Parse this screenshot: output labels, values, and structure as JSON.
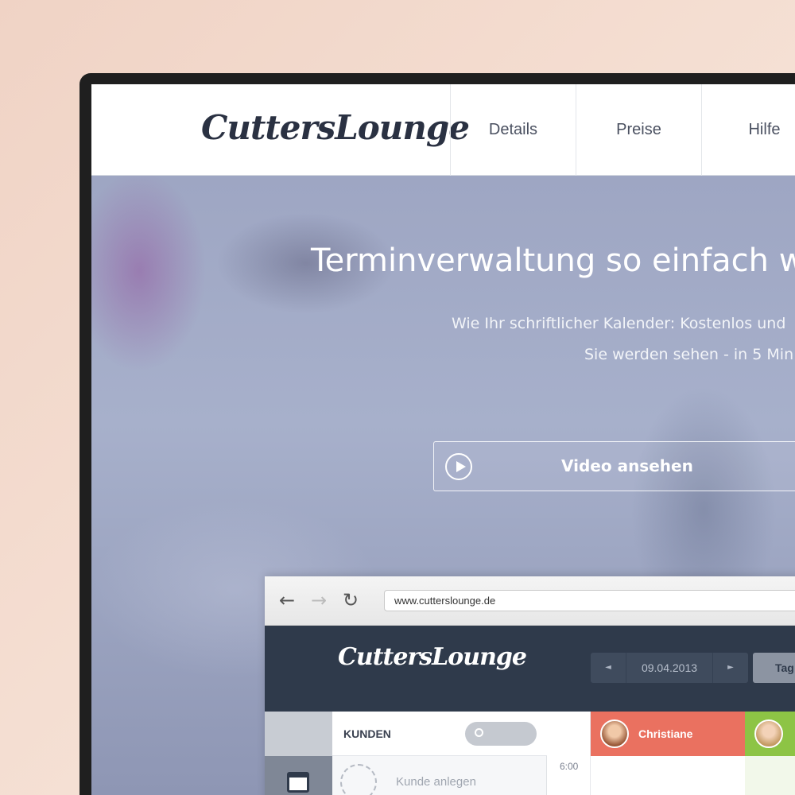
{
  "site": {
    "logo_text": "CuttersLounge",
    "nav": [
      "Details",
      "Preise",
      "Hilfe"
    ]
  },
  "hero": {
    "title": "Terminverwaltung so einfach wi",
    "subtitle_line1": "Wie Ihr schriftlicher Kalender: Kostenlos und",
    "subtitle_line2": "Sie werden sehen - in 5 Min",
    "video_button": "Video ansehen"
  },
  "mockup": {
    "url": "www.cutterslounge.de",
    "app_logo": "CuttersLounge",
    "date": "09.04.2013",
    "prev_arrow": "◄",
    "next_arrow": "►",
    "day_button": "Tag",
    "customers_label": "KUNDEN",
    "add_customer_label": "Kunde anlegen",
    "time_label": "6:00",
    "staff": [
      {
        "name": "Christiane",
        "color": "#ea7160"
      },
      {
        "name": "",
        "color": "#8dc445"
      }
    ]
  },
  "colors": {
    "header_dark": "#2f3a4b",
    "accent_coral": "#ea7160",
    "accent_green": "#8dc445"
  }
}
